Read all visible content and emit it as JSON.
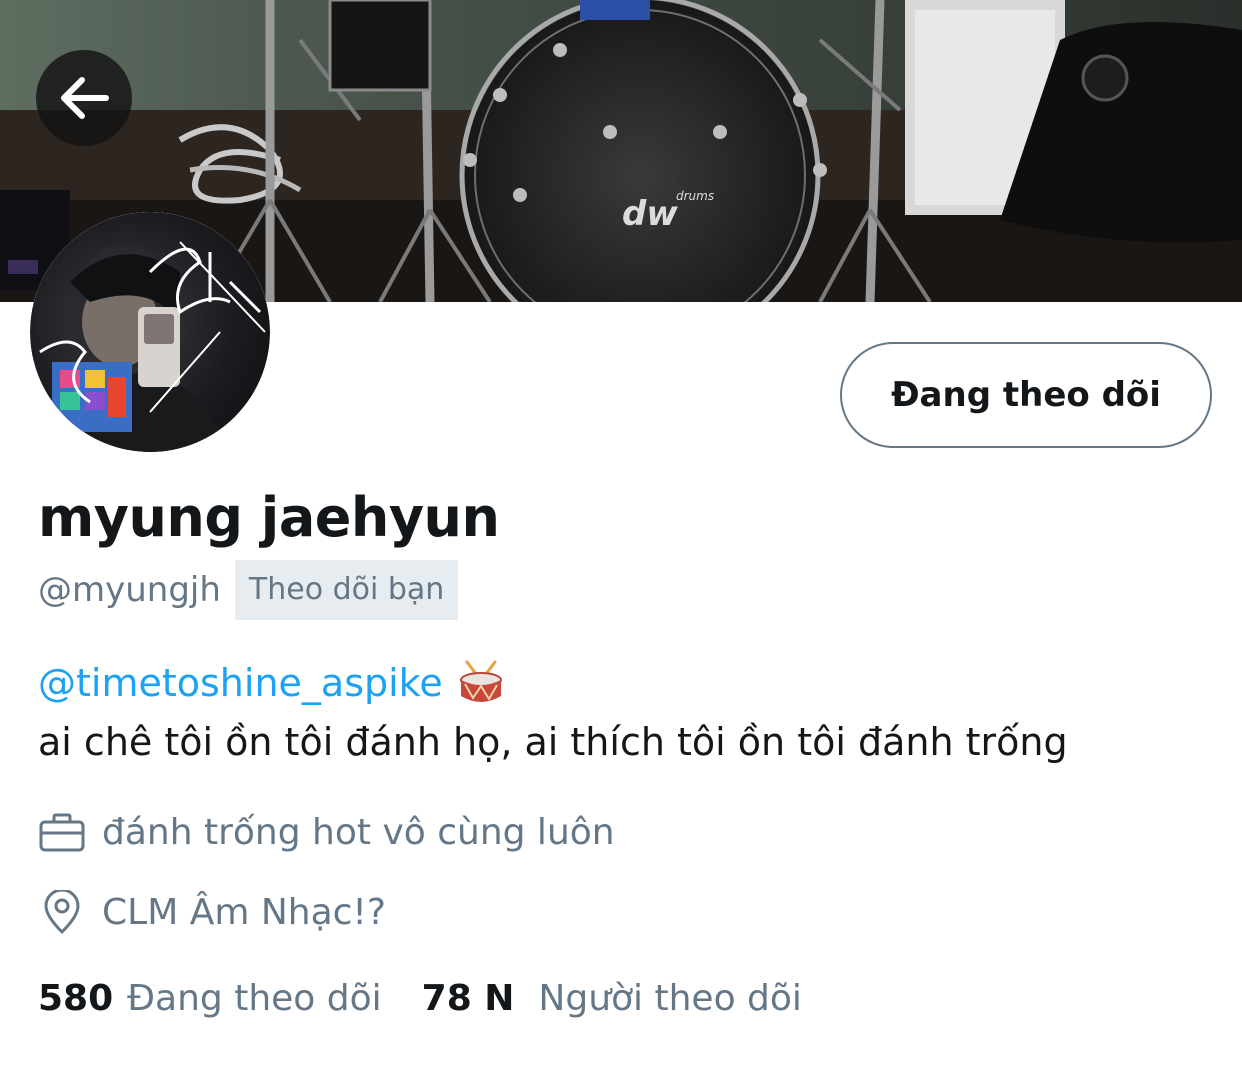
{
  "profile": {
    "name": "myung jaehyun",
    "handle": "@myungjh",
    "follows_you": "Theo dõi bạn",
    "bio_link": "@timetoshine_aspike",
    "bio_text": "ai chê tôi ồn tôi đánh họ, ai thích tôi ồn tôi đánh trống",
    "job": "đánh trống hot vô cùng luôn",
    "location": "CLM Âm Nhạc!?"
  },
  "actions": {
    "follow_label": "Đang theo dõi"
  },
  "stats": {
    "following_count": "580",
    "following_label": "Đang theo dõi",
    "followers_count": "78 N",
    "followers_label": "Người theo dõi"
  },
  "banner": {
    "drum_brand": "dw",
    "drum_brand_small": "drums"
  },
  "icons": {
    "back": "arrow-left-icon",
    "job": "briefcase-icon",
    "location": "map-pin-icon",
    "bio_emoji": "drum-emoji"
  },
  "colors": {
    "link": "#1da1f2",
    "secondary_text": "#657786",
    "badge_bg": "#e6ecf0"
  }
}
